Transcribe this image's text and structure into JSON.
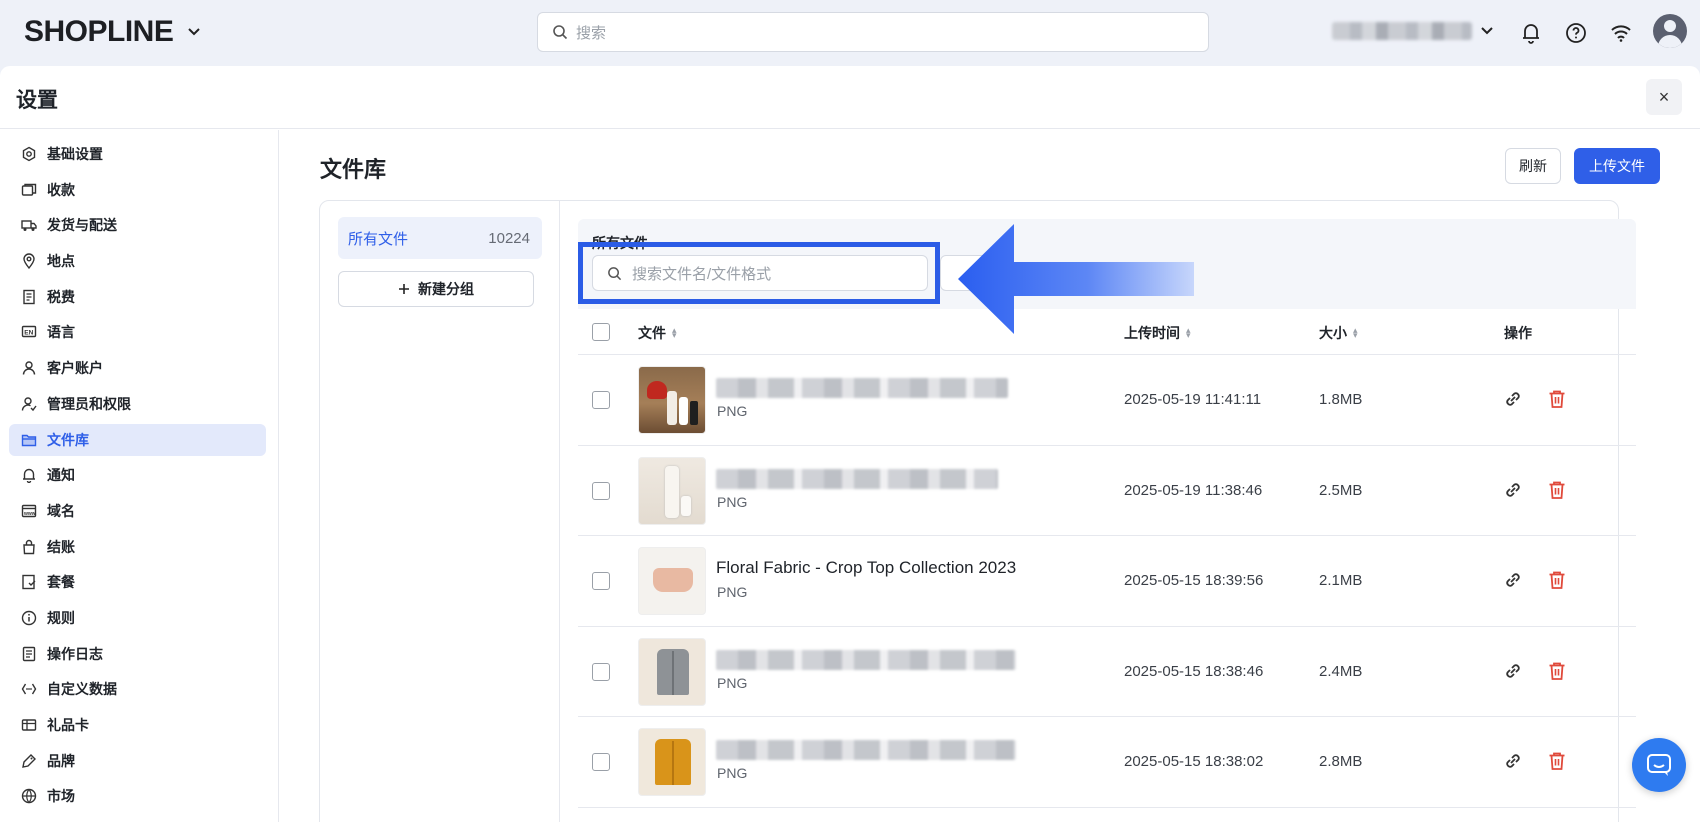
{
  "topbar": {
    "logo": "SHOPLINE",
    "search_placeholder": "搜索"
  },
  "panel": {
    "title": "设置",
    "close": "×"
  },
  "sidebar": {
    "items": [
      {
        "label": "基础设置",
        "icon": "settings-icon"
      },
      {
        "label": "收款",
        "icon": "payment-icon"
      },
      {
        "label": "发货与配送",
        "icon": "truck-icon"
      },
      {
        "label": "地点",
        "icon": "location-icon"
      },
      {
        "label": "税费",
        "icon": "receipt-icon"
      },
      {
        "label": "语言",
        "icon": "language-icon"
      },
      {
        "label": "客户账户",
        "icon": "user-icon"
      },
      {
        "label": "管理员和权限",
        "icon": "user-permission-icon"
      },
      {
        "label": "文件库",
        "icon": "folder-icon",
        "active": true
      },
      {
        "label": "通知",
        "icon": "bell-icon"
      },
      {
        "label": "域名",
        "icon": "domain-icon"
      },
      {
        "label": "结账",
        "icon": "bag-icon"
      },
      {
        "label": "套餐",
        "icon": "plan-icon"
      },
      {
        "label": "规则",
        "icon": "info-icon"
      },
      {
        "label": "操作日志",
        "icon": "log-icon"
      },
      {
        "label": "自定义数据",
        "icon": "code-icon"
      },
      {
        "label": "礼品卡",
        "icon": "gift-card-icon"
      },
      {
        "label": "品牌",
        "icon": "brand-icon"
      },
      {
        "label": "市场",
        "icon": "globe-icon"
      }
    ]
  },
  "main": {
    "title": "文件库",
    "refresh_label": "刷新",
    "upload_label": "上传文件",
    "groups": {
      "all_label": "所有文件",
      "all_count": "10224",
      "new_group_label": "新建分组"
    },
    "filter": {
      "title": "所有文件",
      "search_placeholder": "搜索文件名/文件格式"
    },
    "table": {
      "headers": {
        "file": "文件",
        "upload_time": "上传时间",
        "size": "大小",
        "actions": "操作"
      },
      "rows": [
        {
          "name": "",
          "type": "PNG",
          "date": "2025-05-19 11:41:11",
          "size": "1.8MB"
        },
        {
          "name": "",
          "type": "PNG",
          "date": "2025-05-19 11:38:46",
          "size": "2.5MB"
        },
        {
          "name": "Floral Fabric - Crop Top Collection 2023",
          "type": "PNG",
          "date": "2025-05-15 18:39:56",
          "size": "2.1MB"
        },
        {
          "name": "",
          "type": "PNG",
          "date": "2025-05-15 18:38:46",
          "size": "2.4MB"
        },
        {
          "name": "",
          "type": "PNG",
          "date": "2025-05-15 18:38:02",
          "size": "2.8MB"
        }
      ]
    }
  },
  "colors": {
    "accent": "#2f5fe8",
    "highlight": "#2b5ce6",
    "delete": "#e04a3b"
  }
}
